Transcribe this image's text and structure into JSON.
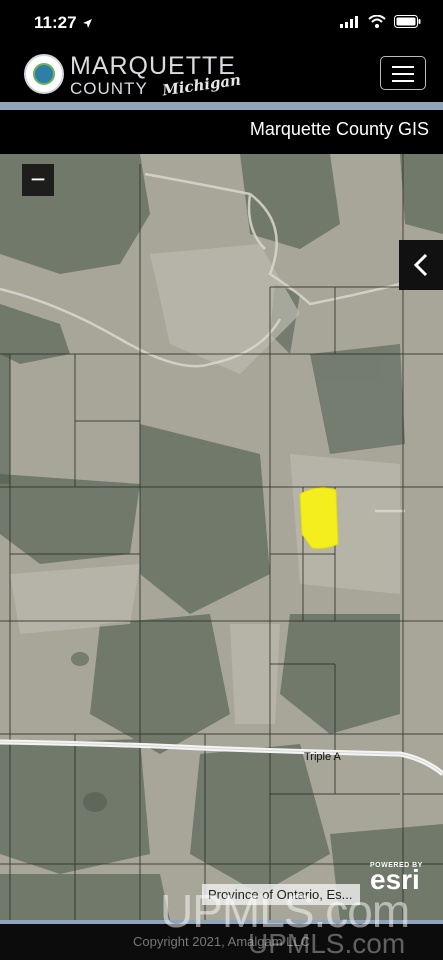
{
  "status_bar": {
    "time": "11:27",
    "icons": [
      "location-arrow-icon",
      "signal-icon",
      "wifi-icon",
      "battery-icon"
    ]
  },
  "header": {
    "logo_title": "MARQUETTE",
    "logo_subtitle": "COUNTY",
    "logo_script": "Michigan",
    "menu_icon": "hamburger-menu-icon"
  },
  "page": {
    "title": "Marquette County GIS"
  },
  "map": {
    "zoom_out_label": "−",
    "panel_toggle_icon": "chevron-left-icon",
    "road_label": "Triple A",
    "highlight_color": "#f5ee1e",
    "esri_powered": "POWERED BY",
    "esri_logo": "esri",
    "attribution": "Province of Ontario, Es..."
  },
  "footer": {
    "copyright": "Copyright 2021, Amalgam LLC"
  },
  "watermark": {
    "large": "UPMLS.com",
    "small": "UPMLS.com"
  },
  "colors": {
    "accent": "#8fa5ba",
    "header_bg": "#000000"
  }
}
